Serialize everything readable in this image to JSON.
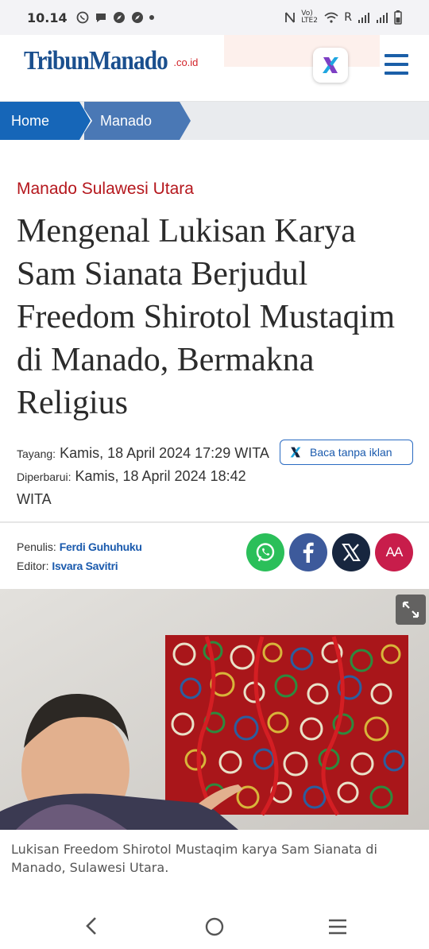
{
  "status_bar": {
    "time": "10.14",
    "network_label": "Vo) LTE2",
    "roaming": "R"
  },
  "header": {
    "logo_text": "TribunManado",
    "logo_domain": ".co.id"
  },
  "breadcrumb": {
    "items": [
      "Home",
      "Manado"
    ]
  },
  "article": {
    "category": "Manado Sulawesi Utara",
    "title": "Mengenal Lukisan Karya Sam Sianata Berjudul Freedom Shirotol Mustaqim di Manado, Bermakna Religius",
    "published_label": "Tayang:",
    "published_value": "Kamis, 18 April 2024 17:29 WITA",
    "updated_label": "Diperbarui:",
    "updated_value": "Kamis, 18 April 2024 18:42 WITA",
    "ad_free_button": "Baca tanpa iklan",
    "writer_label": "Penulis:",
    "writer_name": "Ferdi Guhuhuku",
    "editor_label": "Editor:",
    "editor_name": "Isvara Savitri",
    "font_size_button": "AA",
    "caption": "Lukisan Freedom Shirotol Mustaqim karya Sam Sianata di Manado, Sulawesi Utara."
  },
  "colors": {
    "brand_blue": "#1666b8",
    "category_red": "#b5171d",
    "whatsapp": "#2bbf5a",
    "facebook": "#3d5a9b",
    "x": "#17263f",
    "font_size": "#c81d4b"
  }
}
